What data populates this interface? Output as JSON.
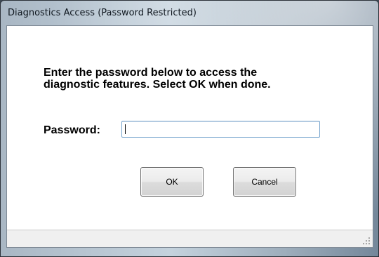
{
  "window": {
    "title": "Diagnostics Access (Password Restricted)"
  },
  "dialog": {
    "instruction": "Enter the password below to access the\ndiagnostic features.  Select OK when done.",
    "password_label": "Password:",
    "password_value": "",
    "ok_label": "OK",
    "cancel_label": "Cancel"
  },
  "colors": {
    "title_bar": "#b5c3cf",
    "client_background": "#ffffff",
    "status_bar": "#f0f0f0",
    "input_border": "#7aa7cf"
  }
}
